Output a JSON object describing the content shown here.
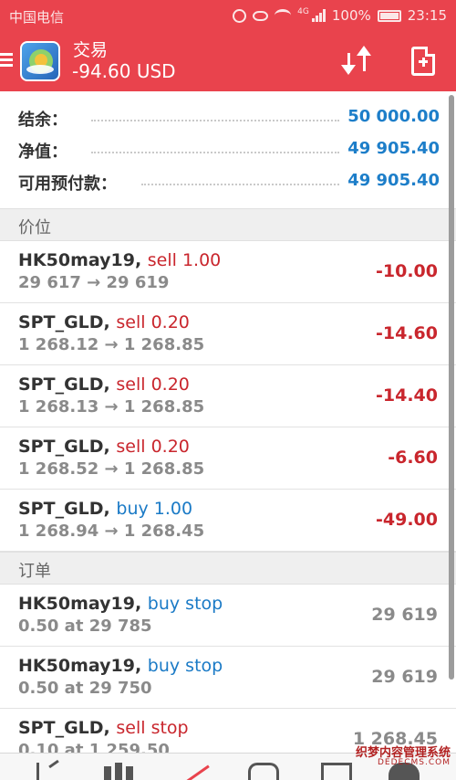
{
  "status_bar": {
    "carrier": "中国电信",
    "network": "4G",
    "battery": "100%",
    "time": "23:15"
  },
  "header": {
    "title": "交易",
    "balance": "-94.60 USD"
  },
  "summary": [
    {
      "label": "结余：",
      "value": "50 000.00"
    },
    {
      "label": "净值：",
      "value": "49 905.40"
    },
    {
      "label": "可用预付款：",
      "value": "49 905.40"
    }
  ],
  "positions": {
    "header": "价位",
    "items": [
      {
        "symbol": "HK50may19",
        "side": "sell 1.00",
        "prices": "29 617 → 29 619",
        "profit": "-10.00"
      },
      {
        "symbol": "SPT_GLD",
        "side": "sell 0.20",
        "prices": "1 268.12 → 1 268.85",
        "profit": "-14.60"
      },
      {
        "symbol": "SPT_GLD",
        "side": "sell 0.20",
        "prices": "1 268.13 → 1 268.85",
        "profit": "-14.40"
      },
      {
        "symbol": "SPT_GLD",
        "side": "sell 0.20",
        "prices": "1 268.52 → 1 268.85",
        "profit": "-6.60"
      },
      {
        "symbol": "SPT_GLD",
        "side": "buy 1.00",
        "prices": "1 268.94 → 1 268.45",
        "profit": "-49.00"
      }
    ]
  },
  "orders": {
    "header": "订单",
    "items": [
      {
        "symbol": "HK50may19",
        "side": "buy stop",
        "detail": "0.50 at 29 785",
        "price": "29 619"
      },
      {
        "symbol": "HK50may19",
        "side": "buy stop",
        "detail": "0.50 at 29 750",
        "price": "29 619"
      },
      {
        "symbol": "SPT_GLD",
        "side": "sell stop",
        "detail": "0.10 at 1 259.50",
        "price": "1 268.45"
      }
    ]
  },
  "bottom_nav": [
    "quotes-icon",
    "chart-icon",
    "trade-icon",
    "history-icon",
    "news-icon",
    "more-icon"
  ],
  "watermark": {
    "line1": "织梦内容管理系统",
    "line2": "DEDECMS.COM"
  },
  "colors": {
    "brand": "#e9434d",
    "sell": "#c9262d",
    "buy": "#1a7ac6",
    "value_blue": "#1d7ec9"
  }
}
